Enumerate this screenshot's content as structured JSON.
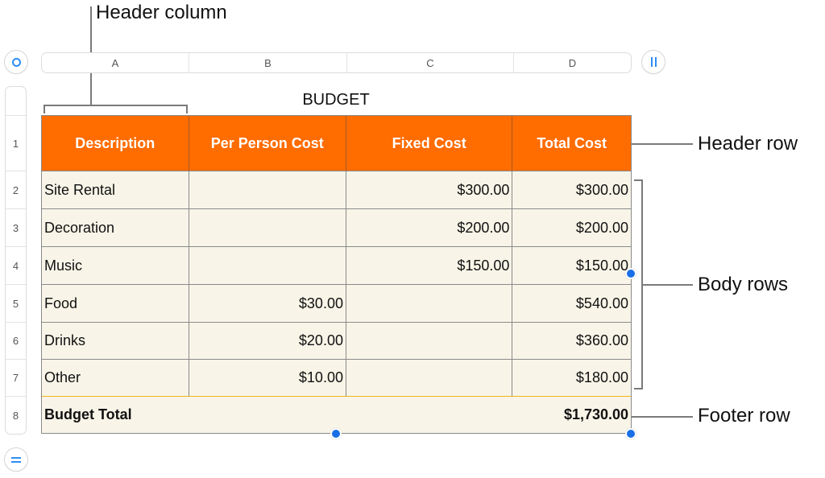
{
  "callouts": {
    "header_column": "Header column",
    "header_row": "Header row",
    "body_rows": "Body rows",
    "footer_row": "Footer row"
  },
  "controls": {
    "select_table_icon": "circle-icon",
    "add_column_icon": "pause-bars-icon",
    "add_row_icon": "equals-icon"
  },
  "column_headers": [
    "A",
    "B",
    "C",
    "D"
  ],
  "row_headers": [
    "",
    "1",
    "2",
    "3",
    "4",
    "5",
    "6",
    "7",
    "8"
  ],
  "table": {
    "title": "BUDGET",
    "header": [
      "Description",
      "Per Person Cost",
      "Fixed Cost",
      "Total Cost"
    ],
    "rows": [
      [
        "Site Rental",
        "",
        "$300.00",
        "$300.00"
      ],
      [
        "Decoration",
        "",
        "$200.00",
        "$200.00"
      ],
      [
        "Music",
        "",
        "$150.00",
        "$150.00"
      ],
      [
        "Food",
        "$30.00",
        "",
        "$540.00"
      ],
      [
        "Drinks",
        "$20.00",
        "",
        "$360.00"
      ],
      [
        "Other",
        "$10.00",
        "",
        "$180.00"
      ]
    ],
    "footer": [
      "Budget Total",
      "",
      "",
      "$1,730.00"
    ]
  },
  "colors": {
    "header_fill": "#ff6c00",
    "body_fill": "#f8f5e8",
    "footer_separator": "#f2b418",
    "accent_blue": "#2d8ef5",
    "handle_blue": "#1a6fe6"
  }
}
